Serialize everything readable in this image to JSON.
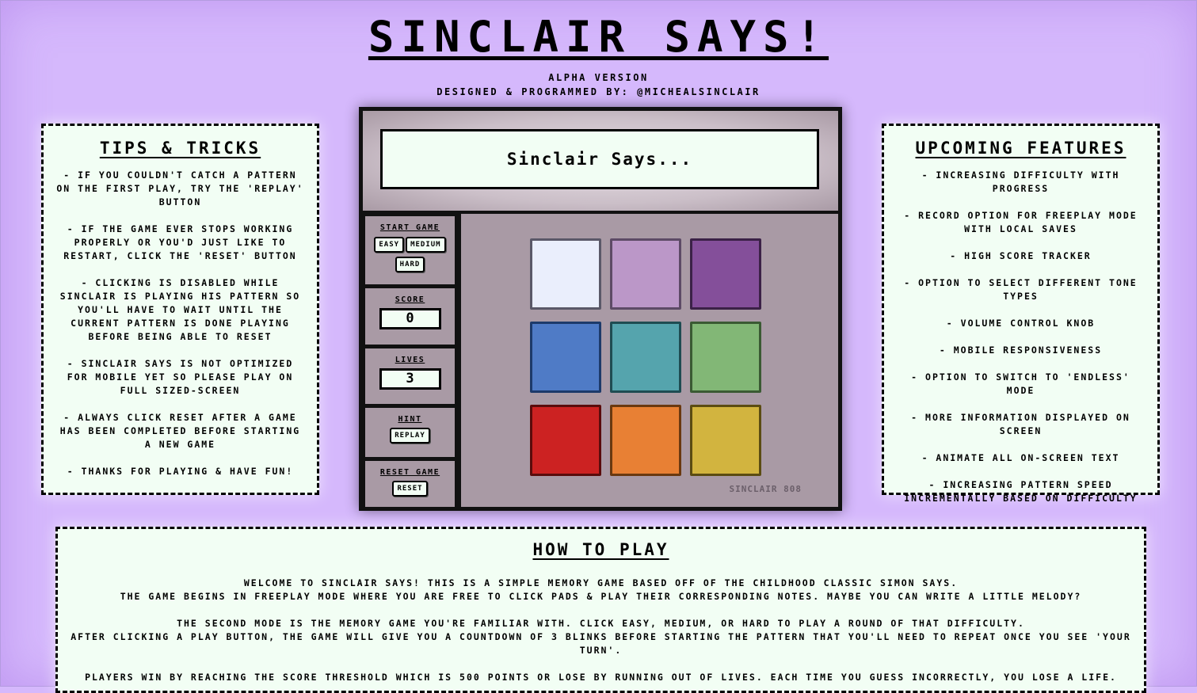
{
  "header": {
    "title": "Sinclair Says!",
    "version": "Alpha Version",
    "credit": "Designed & Programmed By: @MichealSinclair"
  },
  "tips": {
    "heading": "Tips & Tricks",
    "items": [
      "- If you couldn't catch a pattern on the first play, try the 'replay' button",
      "- If the game ever stops working properly or you'd just like to restart, click the 'reset' button",
      "- Clicking is disabled while Sinclair is playing his pattern so you'll have to wait until the current pattern is done playing before being able to reset",
      "- Sinclair Says is not optimized for mobile yet so please play on full sized-screen",
      "- Always click reset after a game has been completed before starting a new game",
      "- Thanks for playing & have fun!"
    ]
  },
  "features": {
    "heading": "Upcoming Features",
    "items": [
      "- Increasing difficulty with progress",
      "- Record option for freeplay mode with local saves",
      "- High score tracker",
      "- Option to select different tone types",
      "- Volume control knob",
      "- Mobile responsiveness",
      "- Option to switch to 'endless' mode",
      "- More information displayed on screen",
      "- Animate all on-screen text",
      "- Increasing pattern speed incrementally based on difficulty"
    ]
  },
  "console": {
    "screen_text": "Sinclair Says...",
    "start_label": "Start Game",
    "easy": "Easy",
    "medium": "Medium",
    "hard": "Hard",
    "score_label": "Score",
    "score_value": "0",
    "lives_label": "Lives",
    "lives_value": "3",
    "hint_label": "Hint",
    "replay": "Replay",
    "reset_label": "Reset Game",
    "reset": "Reset",
    "brand": "Sinclair 808"
  },
  "pads": [
    {
      "color": "#eaeefc",
      "border": "#5a5868"
    },
    {
      "color": "#bb97c8",
      "border": "#5d4a66"
    },
    {
      "color": "#844f9a",
      "border": "#3b2147"
    },
    {
      "color": "#4f7bc6",
      "border": "#1d3a6a"
    },
    {
      "color": "#55a4ad",
      "border": "#1f4c52"
    },
    {
      "color": "#82b776",
      "border": "#3a5a33"
    },
    {
      "color": "#cc2222",
      "border": "#5a0c0c"
    },
    {
      "color": "#e88034",
      "border": "#6a3910"
    },
    {
      "color": "#d2b43f",
      "border": "#5b4c12"
    }
  ],
  "howto": {
    "heading": "How To Play",
    "lines": [
      "Welcome to Sinclair Says! This is a simple memory game based off of the childhood classic Simon Says.",
      "The game begins in freeplay mode where you are free to click pads & play their corresponding notes. Maybe you can write a little melody?",
      "",
      "The second mode is the memory game you're familiar with. Click easy, medium, or hard to play a round of that difficulty.",
      "After clicking a play button, the game will give you a countdown of 3 blinks before starting the pattern that you'll need to repeat once you see 'your turn'.",
      "",
      "Players win by reaching the score threshold which is 500 points or lose by running out of lives. Each time you guess incorrectly, you lose a life."
    ]
  }
}
